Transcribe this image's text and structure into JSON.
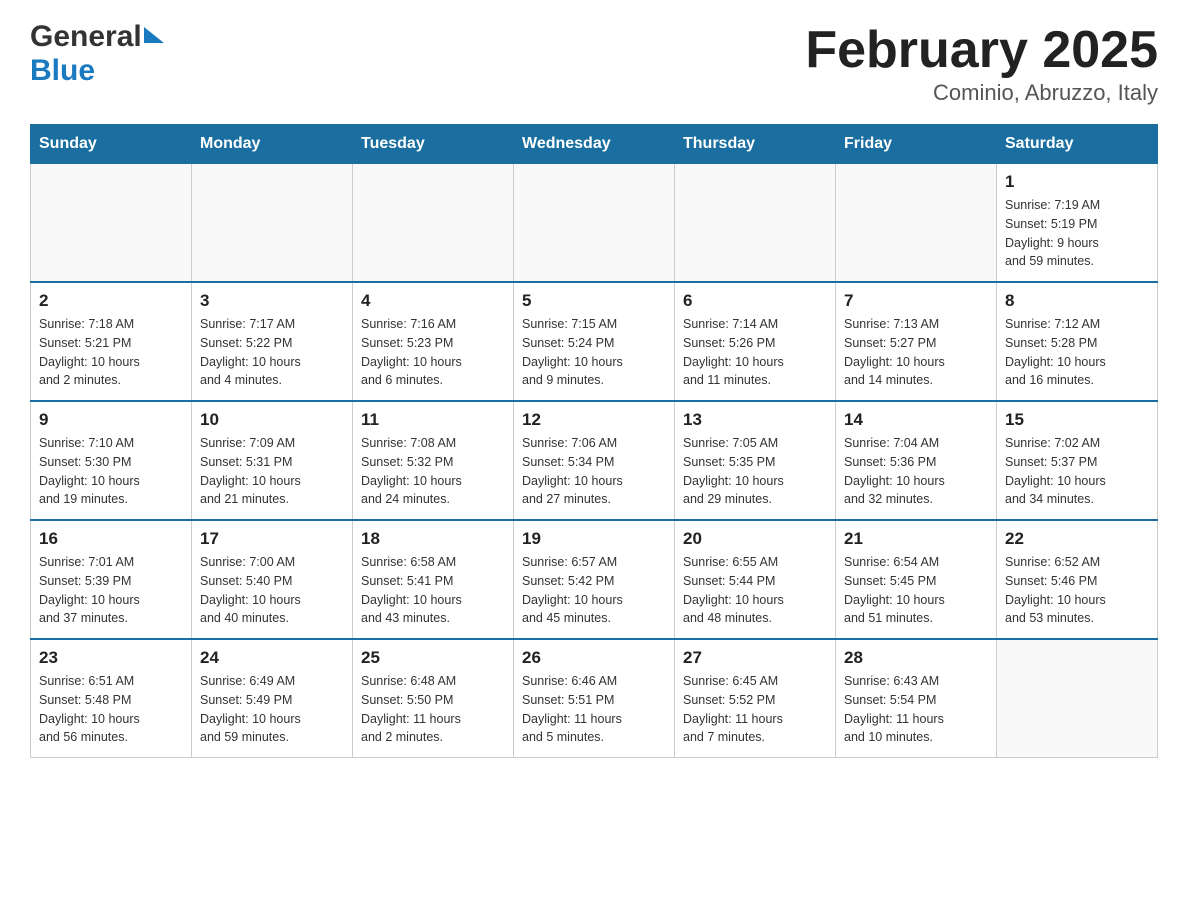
{
  "header": {
    "logo_general": "General",
    "logo_blue": "Blue",
    "title": "February 2025",
    "subtitle": "Cominio, Abruzzo, Italy"
  },
  "days_of_week": [
    "Sunday",
    "Monday",
    "Tuesday",
    "Wednesday",
    "Thursday",
    "Friday",
    "Saturday"
  ],
  "weeks": [
    {
      "days": [
        {
          "number": "",
          "info": ""
        },
        {
          "number": "",
          "info": ""
        },
        {
          "number": "",
          "info": ""
        },
        {
          "number": "",
          "info": ""
        },
        {
          "number": "",
          "info": ""
        },
        {
          "number": "",
          "info": ""
        },
        {
          "number": "1",
          "info": "Sunrise: 7:19 AM\nSunset: 5:19 PM\nDaylight: 9 hours\nand 59 minutes."
        }
      ]
    },
    {
      "days": [
        {
          "number": "2",
          "info": "Sunrise: 7:18 AM\nSunset: 5:21 PM\nDaylight: 10 hours\nand 2 minutes."
        },
        {
          "number": "3",
          "info": "Sunrise: 7:17 AM\nSunset: 5:22 PM\nDaylight: 10 hours\nand 4 minutes."
        },
        {
          "number": "4",
          "info": "Sunrise: 7:16 AM\nSunset: 5:23 PM\nDaylight: 10 hours\nand 6 minutes."
        },
        {
          "number": "5",
          "info": "Sunrise: 7:15 AM\nSunset: 5:24 PM\nDaylight: 10 hours\nand 9 minutes."
        },
        {
          "number": "6",
          "info": "Sunrise: 7:14 AM\nSunset: 5:26 PM\nDaylight: 10 hours\nand 11 minutes."
        },
        {
          "number": "7",
          "info": "Sunrise: 7:13 AM\nSunset: 5:27 PM\nDaylight: 10 hours\nand 14 minutes."
        },
        {
          "number": "8",
          "info": "Sunrise: 7:12 AM\nSunset: 5:28 PM\nDaylight: 10 hours\nand 16 minutes."
        }
      ]
    },
    {
      "days": [
        {
          "number": "9",
          "info": "Sunrise: 7:10 AM\nSunset: 5:30 PM\nDaylight: 10 hours\nand 19 minutes."
        },
        {
          "number": "10",
          "info": "Sunrise: 7:09 AM\nSunset: 5:31 PM\nDaylight: 10 hours\nand 21 minutes."
        },
        {
          "number": "11",
          "info": "Sunrise: 7:08 AM\nSunset: 5:32 PM\nDaylight: 10 hours\nand 24 minutes."
        },
        {
          "number": "12",
          "info": "Sunrise: 7:06 AM\nSunset: 5:34 PM\nDaylight: 10 hours\nand 27 minutes."
        },
        {
          "number": "13",
          "info": "Sunrise: 7:05 AM\nSunset: 5:35 PM\nDaylight: 10 hours\nand 29 minutes."
        },
        {
          "number": "14",
          "info": "Sunrise: 7:04 AM\nSunset: 5:36 PM\nDaylight: 10 hours\nand 32 minutes."
        },
        {
          "number": "15",
          "info": "Sunrise: 7:02 AM\nSunset: 5:37 PM\nDaylight: 10 hours\nand 34 minutes."
        }
      ]
    },
    {
      "days": [
        {
          "number": "16",
          "info": "Sunrise: 7:01 AM\nSunset: 5:39 PM\nDaylight: 10 hours\nand 37 minutes."
        },
        {
          "number": "17",
          "info": "Sunrise: 7:00 AM\nSunset: 5:40 PM\nDaylight: 10 hours\nand 40 minutes."
        },
        {
          "number": "18",
          "info": "Sunrise: 6:58 AM\nSunset: 5:41 PM\nDaylight: 10 hours\nand 43 minutes."
        },
        {
          "number": "19",
          "info": "Sunrise: 6:57 AM\nSunset: 5:42 PM\nDaylight: 10 hours\nand 45 minutes."
        },
        {
          "number": "20",
          "info": "Sunrise: 6:55 AM\nSunset: 5:44 PM\nDaylight: 10 hours\nand 48 minutes."
        },
        {
          "number": "21",
          "info": "Sunrise: 6:54 AM\nSunset: 5:45 PM\nDaylight: 10 hours\nand 51 minutes."
        },
        {
          "number": "22",
          "info": "Sunrise: 6:52 AM\nSunset: 5:46 PM\nDaylight: 10 hours\nand 53 minutes."
        }
      ]
    },
    {
      "days": [
        {
          "number": "23",
          "info": "Sunrise: 6:51 AM\nSunset: 5:48 PM\nDaylight: 10 hours\nand 56 minutes."
        },
        {
          "number": "24",
          "info": "Sunrise: 6:49 AM\nSunset: 5:49 PM\nDaylight: 10 hours\nand 59 minutes."
        },
        {
          "number": "25",
          "info": "Sunrise: 6:48 AM\nSunset: 5:50 PM\nDaylight: 11 hours\nand 2 minutes."
        },
        {
          "number": "26",
          "info": "Sunrise: 6:46 AM\nSunset: 5:51 PM\nDaylight: 11 hours\nand 5 minutes."
        },
        {
          "number": "27",
          "info": "Sunrise: 6:45 AM\nSunset: 5:52 PM\nDaylight: 11 hours\nand 7 minutes."
        },
        {
          "number": "28",
          "info": "Sunrise: 6:43 AM\nSunset: 5:54 PM\nDaylight: 11 hours\nand 10 minutes."
        },
        {
          "number": "",
          "info": ""
        }
      ]
    }
  ]
}
